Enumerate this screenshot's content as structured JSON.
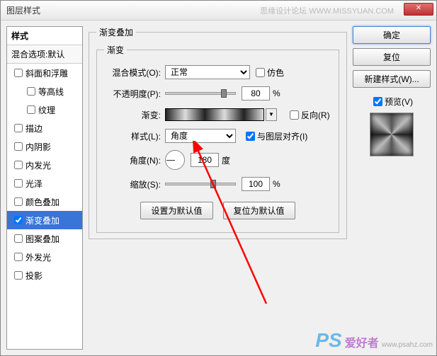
{
  "window": {
    "title": "图层样式",
    "watermark": "思缘设计论坛  WWW.MISSYUAN.COM"
  },
  "left": {
    "header": "样式",
    "default_label": "混合选项:默认",
    "items": [
      {
        "label": "斜面和浮雕",
        "checked": false,
        "indent": false,
        "active": false
      },
      {
        "label": "等高线",
        "checked": false,
        "indent": true,
        "active": false
      },
      {
        "label": "纹理",
        "checked": false,
        "indent": true,
        "active": false
      },
      {
        "label": "描边",
        "checked": false,
        "indent": false,
        "active": false
      },
      {
        "label": "内阴影",
        "checked": false,
        "indent": false,
        "active": false
      },
      {
        "label": "内发光",
        "checked": false,
        "indent": false,
        "active": false
      },
      {
        "label": "光泽",
        "checked": false,
        "indent": false,
        "active": false
      },
      {
        "label": "颜色叠加",
        "checked": false,
        "indent": false,
        "active": false
      },
      {
        "label": "渐变叠加",
        "checked": true,
        "indent": false,
        "active": true
      },
      {
        "label": "图案叠加",
        "checked": false,
        "indent": false,
        "active": false
      },
      {
        "label": "外发光",
        "checked": false,
        "indent": false,
        "active": false
      },
      {
        "label": "投影",
        "checked": false,
        "indent": false,
        "active": false
      }
    ]
  },
  "center": {
    "group_title": "渐变叠加",
    "inner_title": "渐变",
    "blend_mode_label": "混合模式(O):",
    "blend_mode_value": "正常",
    "dither_label": "仿色",
    "opacity_label": "不透明度(P):",
    "opacity_value": "80",
    "percent": "%",
    "gradient_label": "渐变:",
    "reverse_label": "反向(R)",
    "style_label": "样式(L):",
    "style_value": "角度",
    "align_label": "与图层对齐(I)",
    "angle_label": "角度(N):",
    "angle_value": "180",
    "degree": "度",
    "scale_label": "缩放(S):",
    "scale_value": "100",
    "make_default": "设置为默认值",
    "reset_default": "复位为默认值"
  },
  "right": {
    "ok": "确定",
    "cancel": "复位",
    "new_style": "新建样式(W)...",
    "preview_label": "预览(V)"
  },
  "bottom_watermark": {
    "ps": "PS",
    "text1": "爱好者",
    "text2": "www.psahz.com"
  }
}
